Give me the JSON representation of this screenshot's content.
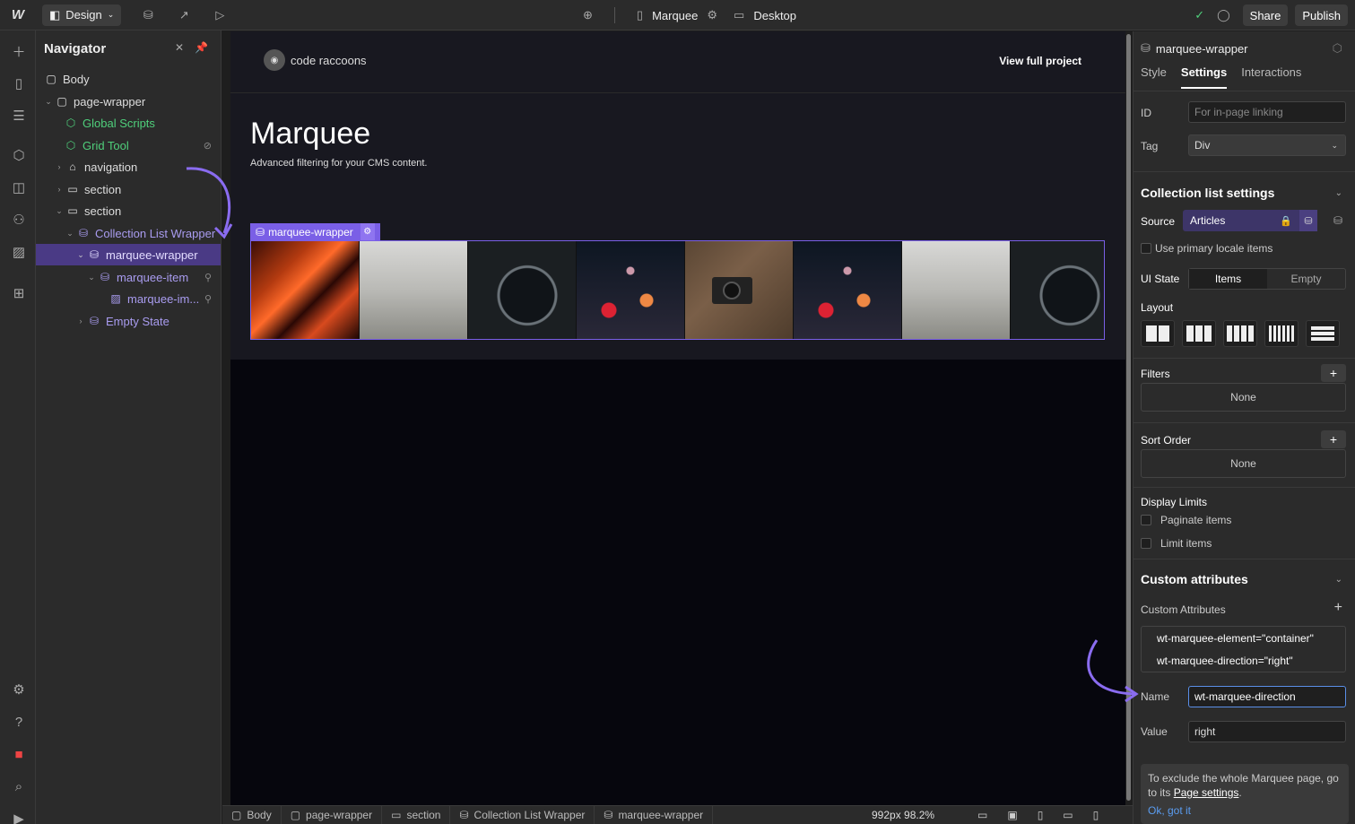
{
  "topbar": {
    "logo": "W",
    "mode": "Design",
    "page_name": "Marquee",
    "breakpoint": "Desktop",
    "share": "Share",
    "publish": "Publish"
  },
  "navigator": {
    "title": "Navigator",
    "items": [
      {
        "label": "Body"
      },
      {
        "label": "page-wrapper"
      },
      {
        "label": "Global Scripts"
      },
      {
        "label": "Grid Tool"
      },
      {
        "label": "navigation"
      },
      {
        "label": "section"
      },
      {
        "label": "section"
      },
      {
        "label": "Collection List Wrapper"
      },
      {
        "label": "marquee-wrapper"
      },
      {
        "label": "marquee-item"
      },
      {
        "label": "marquee-im..."
      },
      {
        "label": "Empty State"
      }
    ]
  },
  "canvas": {
    "logo_text": "code raccoons",
    "view_link": "View full project",
    "title": "Marquee",
    "subtitle": "Advanced filtering for your CMS content.",
    "selected_label": "marquee-wrapper",
    "images": [
      "neon",
      "cafe",
      "clock",
      "bokeh",
      "camera",
      "bokeh",
      "cafe",
      "clock"
    ]
  },
  "panel": {
    "element_name": "marquee-wrapper",
    "tabs": [
      "Style",
      "Settings",
      "Interactions"
    ],
    "id_label": "ID",
    "id_placeholder": "For in-page linking",
    "tag_label": "Tag",
    "tag_value": "Div",
    "cls_title": "Collection list settings",
    "source_label": "Source",
    "source_value": "Articles",
    "primary_locale": "Use primary locale items",
    "ui_state_label": "UI State",
    "ui_state_items": "Items",
    "ui_state_empty": "Empty",
    "layout_label": "Layout",
    "filters_label": "Filters",
    "filters_value": "None",
    "sort_label": "Sort Order",
    "sort_value": "None",
    "display_limits": "Display Limits",
    "paginate": "Paginate items",
    "limit": "Limit items",
    "custom_attr_title": "Custom attributes",
    "custom_attr_sub": "Custom Attributes",
    "attrs": [
      "wt-marquee-element=\"container\"",
      "wt-marquee-direction=\"right\""
    ],
    "name_label": "Name",
    "name_value": "wt-marquee-direction",
    "value_label": "Value",
    "value_value": "right",
    "tip_text": "To exclude the whole Marquee page, go to its",
    "tip_link": "Page settings",
    "tip_ok": "Ok, got it"
  },
  "bottom": {
    "crumbs": [
      "Body",
      "page-wrapper",
      "section",
      "Collection List Wrapper",
      "marquee-wrapper"
    ],
    "zoom": "992px 98.2%"
  },
  "colors": {
    "accent": "#7a5fe6",
    "selection": "#4a3a85",
    "green": "#4fcf7b"
  }
}
